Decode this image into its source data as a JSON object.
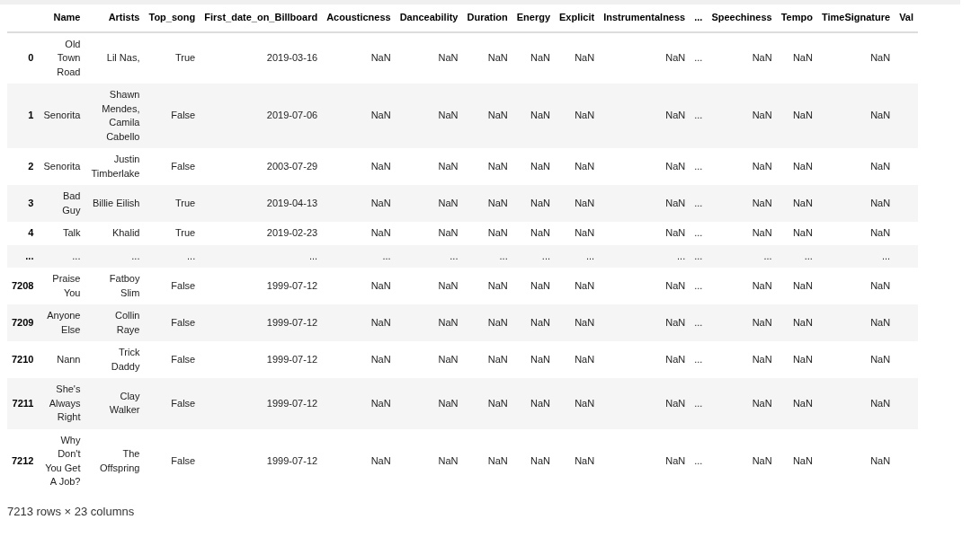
{
  "table": {
    "columns": [
      "",
      "Name",
      "Artists",
      "Top_song",
      "First_date_on_Billboard",
      "Acousticness",
      "Danceability",
      "Duration",
      "Energy",
      "Explicit",
      "Instrumentalness",
      "...",
      "Speechiness",
      "Tempo",
      "TimeSignature",
      "Val"
    ],
    "rows": [
      [
        "0",
        "Old Town Road",
        "Lil Nas,",
        "True",
        "2019-03-16",
        "NaN",
        "NaN",
        "NaN",
        "NaN",
        "NaN",
        "NaN",
        "...",
        "NaN",
        "NaN",
        "NaN"
      ],
      [
        "1",
        "Senorita",
        "Shawn Mendes, Camila Cabello",
        "False",
        "2019-07-06",
        "NaN",
        "NaN",
        "NaN",
        "NaN",
        "NaN",
        "NaN",
        "...",
        "NaN",
        "NaN",
        "NaN"
      ],
      [
        "2",
        "Senorita",
        "Justin Timberlake",
        "False",
        "2003-07-29",
        "NaN",
        "NaN",
        "NaN",
        "NaN",
        "NaN",
        "NaN",
        "...",
        "NaN",
        "NaN",
        "NaN"
      ],
      [
        "3",
        "Bad Guy",
        "Billie Eilish",
        "True",
        "2019-04-13",
        "NaN",
        "NaN",
        "NaN",
        "NaN",
        "NaN",
        "NaN",
        "...",
        "NaN",
        "NaN",
        "NaN"
      ],
      [
        "4",
        "Talk",
        "Khalid",
        "True",
        "2019-02-23",
        "NaN",
        "NaN",
        "NaN",
        "NaN",
        "NaN",
        "NaN",
        "...",
        "NaN",
        "NaN",
        "NaN"
      ],
      [
        "...",
        "...",
        "...",
        "...",
        "...",
        "...",
        "...",
        "...",
        "...",
        "...",
        "...",
        "...",
        "...",
        "...",
        "..."
      ],
      [
        "7208",
        "Praise You",
        "Fatboy Slim",
        "False",
        "1999-07-12",
        "NaN",
        "NaN",
        "NaN",
        "NaN",
        "NaN",
        "NaN",
        "...",
        "NaN",
        "NaN",
        "NaN"
      ],
      [
        "7209",
        "Anyone Else",
        "Collin Raye",
        "False",
        "1999-07-12",
        "NaN",
        "NaN",
        "NaN",
        "NaN",
        "NaN",
        "NaN",
        "...",
        "NaN",
        "NaN",
        "NaN"
      ],
      [
        "7210",
        "Nann",
        "Trick Daddy",
        "False",
        "1999-07-12",
        "NaN",
        "NaN",
        "NaN",
        "NaN",
        "NaN",
        "NaN",
        "...",
        "NaN",
        "NaN",
        "NaN"
      ],
      [
        "7211",
        "She's Always Right",
        "Clay Walker",
        "False",
        "1999-07-12",
        "NaN",
        "NaN",
        "NaN",
        "NaN",
        "NaN",
        "NaN",
        "...",
        "NaN",
        "NaN",
        "NaN"
      ],
      [
        "7212",
        "Why Don't You Get A Job?",
        "The Offspring",
        "False",
        "1999-07-12",
        "NaN",
        "NaN",
        "NaN",
        "NaN",
        "NaN",
        "NaN",
        "...",
        "NaN",
        "NaN",
        "NaN"
      ]
    ]
  },
  "footer": "7213 rows × 23 columns"
}
